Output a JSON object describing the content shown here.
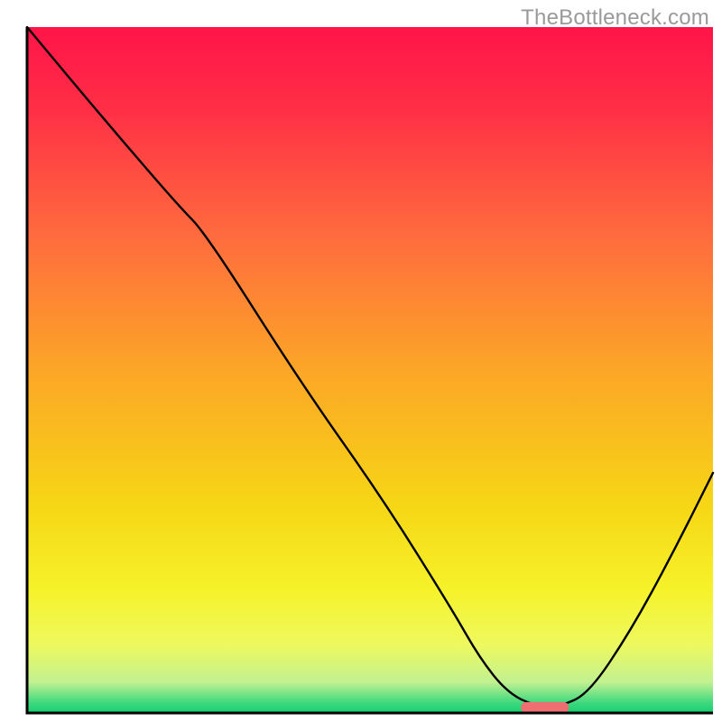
{
  "watermark": "TheBottleneck.com",
  "chart_data": {
    "type": "line",
    "title": "",
    "xlabel": "",
    "ylabel": "",
    "xlim": [
      0,
      100
    ],
    "ylim": [
      0,
      100
    ],
    "background_gradient": {
      "stops": [
        {
          "offset": 0.0,
          "color": "#ff1448"
        },
        {
          "offset": 0.12,
          "color": "#ff2f46"
        },
        {
          "offset": 0.3,
          "color": "#ff6a3e"
        },
        {
          "offset": 0.5,
          "color": "#fca627"
        },
        {
          "offset": 0.7,
          "color": "#f6d715"
        },
        {
          "offset": 0.82,
          "color": "#f6f22a"
        },
        {
          "offset": 0.9,
          "color": "#eef95e"
        },
        {
          "offset": 0.955,
          "color": "#c2f191"
        },
        {
          "offset": 0.985,
          "color": "#3fd97e"
        },
        {
          "offset": 1.0,
          "color": "#15cf72"
        }
      ]
    },
    "series": [
      {
        "name": "bottleneck-curve",
        "color": "#000000",
        "width": 2.4,
        "x": [
          0,
          10,
          22,
          26,
          40,
          52,
          62,
          66,
          70,
          74,
          78,
          82,
          88,
          94,
          100
        ],
        "y": [
          100,
          88,
          74,
          70,
          48,
          31,
          15,
          8,
          3,
          1,
          1,
          3,
          12,
          23,
          35
        ]
      }
    ],
    "markers": [
      {
        "name": "target-capsule",
        "shape": "capsule",
        "color": "#ee6e72",
        "x_center": 75.5,
        "y_center": 0.8,
        "width_x": 7.0,
        "height_y": 1.6
      }
    ],
    "axes": {
      "color": "#000000",
      "width": 3
    }
  }
}
